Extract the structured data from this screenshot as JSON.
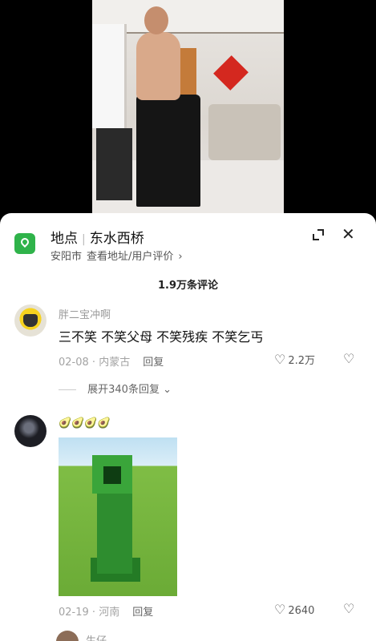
{
  "location": {
    "label": "地点",
    "name": "东水西桥",
    "city": "安阳市",
    "links": "查看地址/用户评价"
  },
  "comments_count": "1.9万条评论",
  "comments": [
    {
      "username": "胖二宝冲啊",
      "text": "三不笑 不笑父母 不笑残疾 不笑乞丐",
      "date": "02-08",
      "region": "内蒙古",
      "reply_label": "回复",
      "likes": "2.2万",
      "more_replies": "展开340条回复"
    },
    {
      "username": "",
      "emoji_text": "🥑🥑🥑🥑",
      "date": "02-19",
      "region": "河南",
      "reply_label": "回复",
      "likes": "2640"
    },
    {
      "username": "生仔"
    }
  ],
  "icons": {
    "heart": "♡",
    "dislike": "♡",
    "close": "✕",
    "chevron": "⌄",
    "arrow": "›"
  },
  "colors": {
    "location_green": "#2fb34a"
  }
}
